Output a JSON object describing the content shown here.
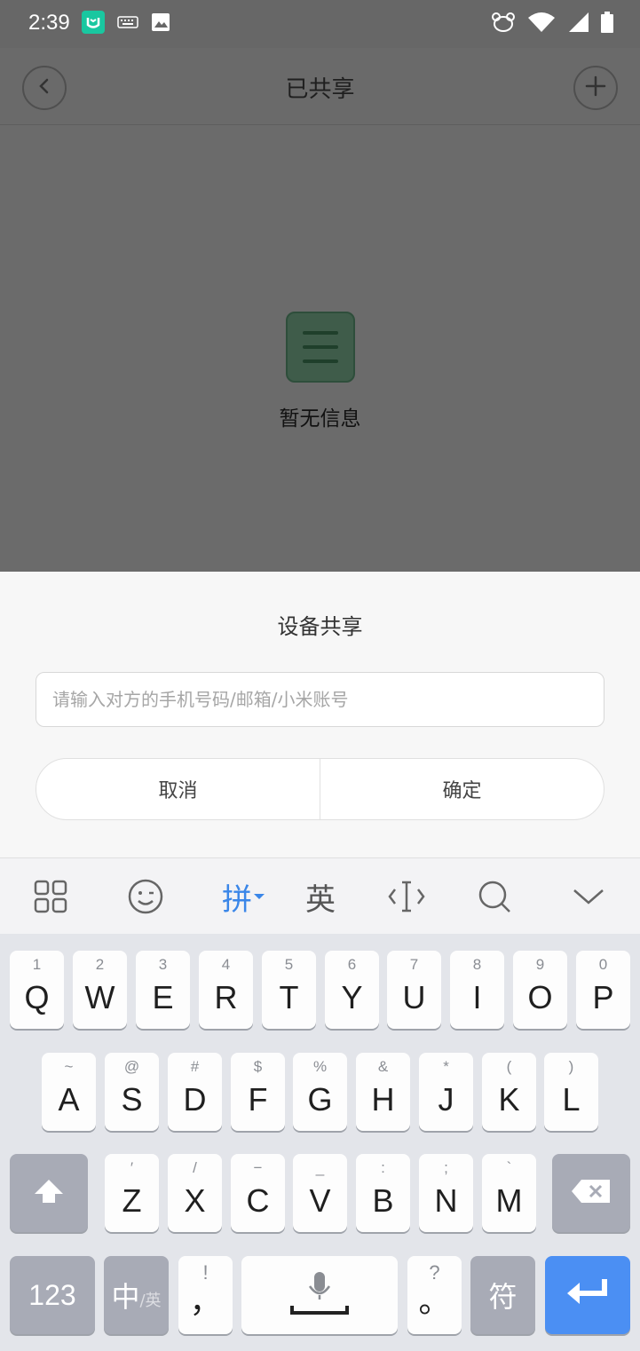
{
  "status_bar": {
    "time": "2:39",
    "left_icons": [
      "mi-home-icon",
      "keyboard-icon",
      "image-icon"
    ],
    "right_icons": [
      "bear-icon",
      "wifi-icon",
      "cell-signal-icon",
      "battery-icon"
    ]
  },
  "header": {
    "title": "已共享",
    "back_icon": "chevron-left-icon",
    "add_icon": "plus-icon"
  },
  "empty_state": {
    "icon": "list-icon",
    "text": "暂无信息"
  },
  "dialog": {
    "title": "设备共享",
    "input_placeholder": "请输入对方的手机号码/邮箱/小米账号",
    "input_value": "",
    "cancel_label": "取消",
    "confirm_label": "确定"
  },
  "ime_toolbar": {
    "pinyin_label": "拼",
    "english_label": "英",
    "accent_color": "#3a86e8"
  },
  "keyboard": {
    "row1": [
      {
        "hint": "1",
        "key": "Q"
      },
      {
        "hint": "2",
        "key": "W"
      },
      {
        "hint": "3",
        "key": "E"
      },
      {
        "hint": "4",
        "key": "R"
      },
      {
        "hint": "5",
        "key": "T"
      },
      {
        "hint": "6",
        "key": "Y"
      },
      {
        "hint": "7",
        "key": "U"
      },
      {
        "hint": "8",
        "key": "I"
      },
      {
        "hint": "9",
        "key": "O"
      },
      {
        "hint": "0",
        "key": "P"
      }
    ],
    "row2": [
      {
        "hint": "~",
        "key": "A"
      },
      {
        "hint": "@",
        "key": "S"
      },
      {
        "hint": "#",
        "key": "D"
      },
      {
        "hint": "$",
        "key": "F"
      },
      {
        "hint": "%",
        "key": "G"
      },
      {
        "hint": "&",
        "key": "H"
      },
      {
        "hint": "*",
        "key": "J"
      },
      {
        "hint": "(",
        "key": "K"
      },
      {
        "hint": ")",
        "key": "L"
      }
    ],
    "row3": [
      {
        "hint": "′",
        "key": "Z"
      },
      {
        "hint": "/",
        "key": "X"
      },
      {
        "hint": "−",
        "key": "C"
      },
      {
        "hint": "_",
        "key": "V"
      },
      {
        "hint": ":",
        "key": "B"
      },
      {
        "hint": ";",
        "key": "N"
      },
      {
        "hint": "`",
        "key": "M"
      }
    ],
    "num_label": "123",
    "lang_main": "中",
    "lang_sub": "/英",
    "comma_hint": "!",
    "comma_key": "，",
    "period_hint": "?",
    "period_key": "。",
    "symbol_label": "符"
  }
}
